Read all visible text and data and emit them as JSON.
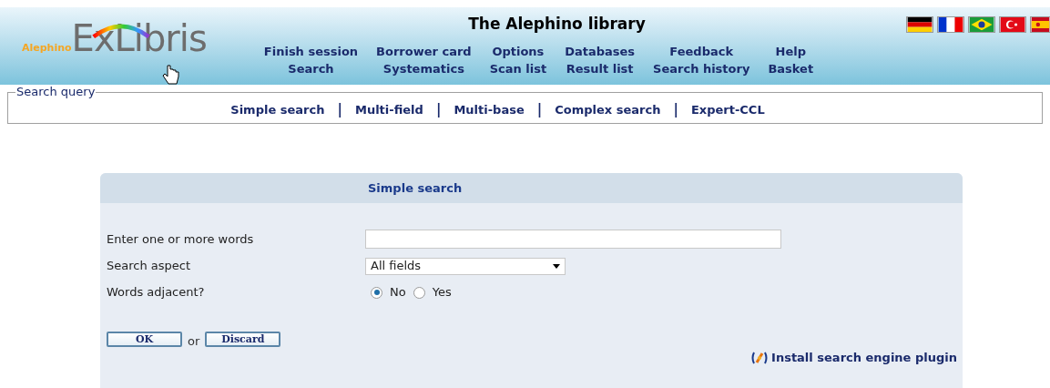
{
  "header": {
    "logo_small": "Alephino",
    "logo": "ExLibris",
    "title": "The Alephino library",
    "menu": [
      [
        "Finish session",
        "Search"
      ],
      [
        "Borrower card",
        "Systematics"
      ],
      [
        "Options",
        "Scan list"
      ],
      [
        "Databases",
        "Result list"
      ],
      [
        "Feedback",
        "Search history"
      ],
      [
        "Help",
        "Basket"
      ]
    ]
  },
  "search_query": {
    "legend": "Search query",
    "links": [
      "Simple search",
      "Multi-field",
      "Multi-base",
      "Complex search",
      "Expert-CCL"
    ],
    "separator": "|"
  },
  "form": {
    "title": "Simple search",
    "words": {
      "label": "Enter one or more words"
    },
    "aspect": {
      "label": "Search aspect",
      "value": "All fields"
    },
    "adjacent": {
      "label": "Words adjacent?",
      "options": [
        {
          "label": "No",
          "selected": true
        },
        {
          "label": "Yes",
          "selected": false
        }
      ]
    },
    "ok": "OK",
    "or": "or",
    "discard": "Discard",
    "plugin": "Install search engine plugin"
  }
}
